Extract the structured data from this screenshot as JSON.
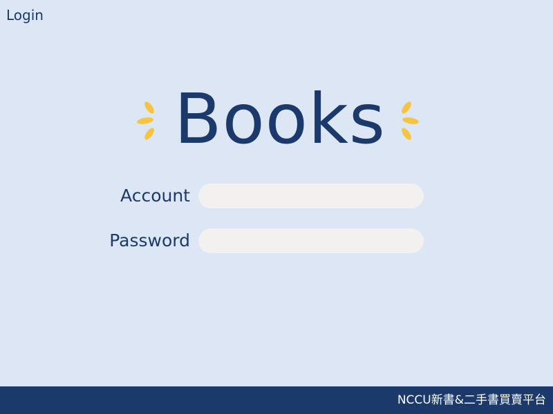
{
  "header": {
    "title": "Login"
  },
  "logo": {
    "text": "Books",
    "sparkle_icon": "sparkle-icon",
    "sparkle_color": "#f5c542"
  },
  "form": {
    "account": {
      "label": "Account",
      "value": "",
      "placeholder": ""
    },
    "password": {
      "label": "Password",
      "value": "",
      "placeholder": ""
    }
  },
  "footer": {
    "text": "NCCU新書&二手書買賣平台"
  },
  "colors": {
    "background": "#dce6f5",
    "primary": "#1b3a6b",
    "input_fill": "#f2f1f0",
    "accent": "#f5c542"
  }
}
